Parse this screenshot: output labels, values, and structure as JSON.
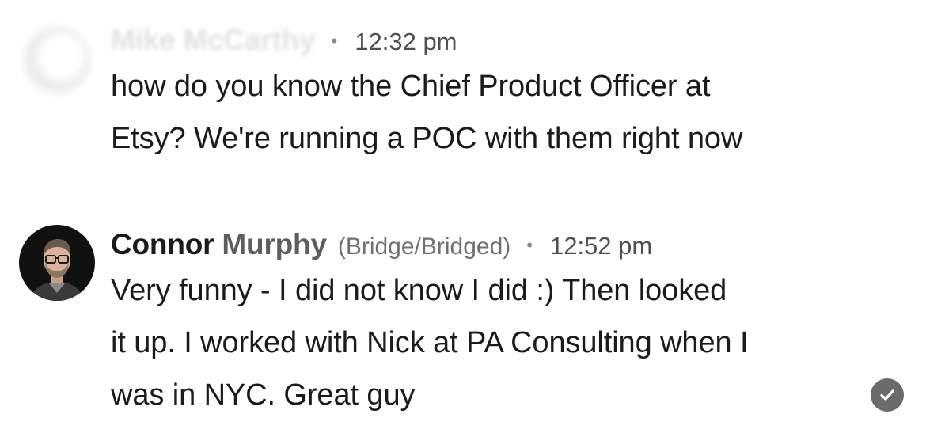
{
  "messages": [
    {
      "sender_name": "Mike McCarthy",
      "time": "12:32 pm",
      "separator": "•",
      "text_lines": [
        "how do you know the Chief Product Officer at",
        "Etsy? We're running a POC with them right now"
      ],
      "avatar": "blurred-avatar"
    },
    {
      "sender_first": "Connor",
      "sender_last": "Murphy",
      "affiliation": "(Bridge/Bridged)",
      "separator": "•",
      "time": "12:52 pm",
      "text_lines": [
        "Very funny - I did not know I did :) Then looked",
        "it up. I worked with Nick at PA Consulting when I",
        "was in NYC. Great guy"
      ],
      "avatar": "person-photo-avatar",
      "read_receipt_icon": "checkmark-circle-icon"
    }
  ],
  "colors": {
    "text": "#1b1b1b",
    "secondary": "#707070",
    "check_bg": "#6b6b6b"
  }
}
